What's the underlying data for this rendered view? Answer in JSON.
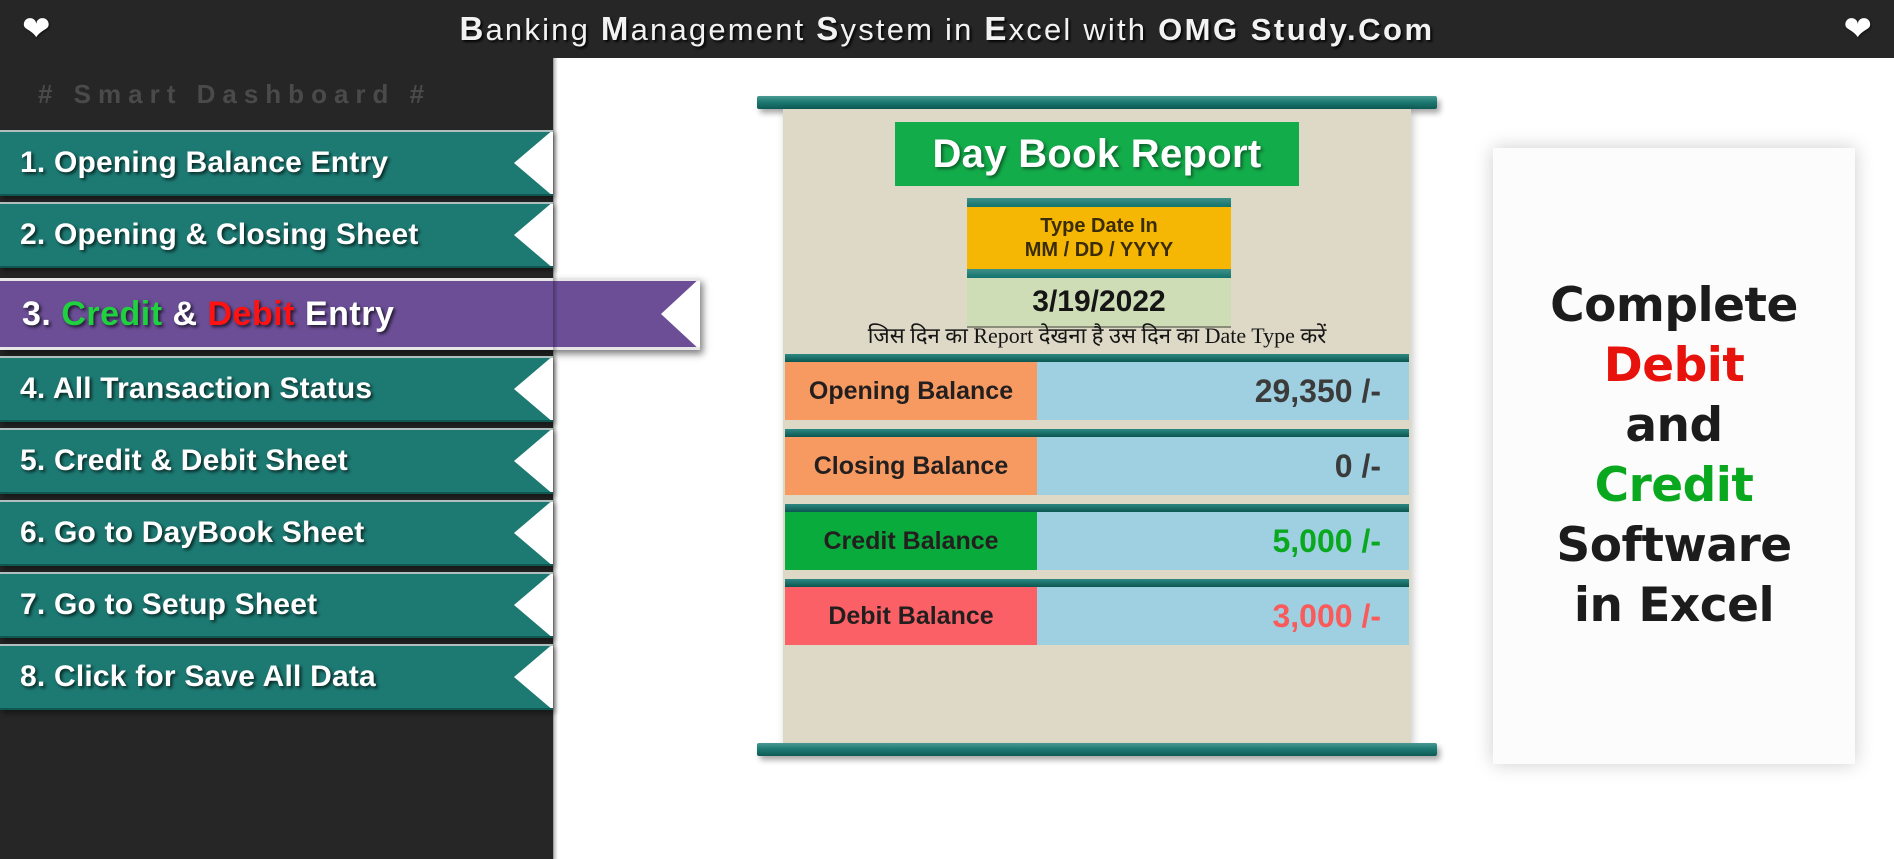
{
  "header": {
    "heart_icon": "heart",
    "title_parts": [
      {
        "text": "B",
        "style": "cap"
      },
      {
        "text": "anking ",
        "style": "normal"
      },
      {
        "text": "M",
        "style": "cap"
      },
      {
        "text": "anagement ",
        "style": "normal"
      },
      {
        "text": "S",
        "style": "cap"
      },
      {
        "text": "ystem in ",
        "style": "normal"
      },
      {
        "text": "E",
        "style": "cap"
      },
      {
        "text": "xcel with ",
        "style": "normal"
      },
      {
        "text": "OMG Study.Com",
        "style": "bold"
      }
    ],
    "title_plain": "Banking Management System in Excel with OMG Study.Com"
  },
  "sidebar": {
    "section_label": "# Smart Dashboard #",
    "items": [
      {
        "label": "1. Opening Balance Entry",
        "active": false
      },
      {
        "label": "2. Opening & Closing Sheet",
        "active": false
      },
      {
        "label": "3.  Credit & Debit Entry",
        "active": true,
        "parts": [
          {
            "text": "3. ",
            "color": "white"
          },
          {
            "text": " Credit ",
            "color": "green"
          },
          {
            "text": "& ",
            "color": "white"
          },
          {
            "text": "Debit ",
            "color": "red"
          },
          {
            "text": "Entry",
            "color": "white"
          }
        ]
      },
      {
        "label": "4.  All Transaction Status",
        "active": false
      },
      {
        "label": "5.  Credit & Debit Sheet",
        "active": false
      },
      {
        "label": "6.  Go to DayBook Sheet",
        "active": false
      },
      {
        "label": "7.  Go to Setup Sheet",
        "active": false
      },
      {
        "label": "8.  Click for Save All Data",
        "active": false
      }
    ]
  },
  "report": {
    "title": "Day Book Report",
    "date_hint_line1": "Type Date In",
    "date_hint_line2": "MM / DD / YYYY",
    "date_value": "3/19/2022",
    "date_note": "जिस दिन का Report देखना है उस दिन का Date Type करें",
    "rows": [
      {
        "name": "Opening Balance",
        "value": "29,350 /-",
        "name_bg": "#f79a62",
        "value_color": "#3b3b3b"
      },
      {
        "name": "Closing Balance",
        "value": "0 /-",
        "name_bg": "#f79a62",
        "value_color": "#3b3b3b"
      },
      {
        "name": "Credit Balance",
        "value": "5,000 /-",
        "name_bg": "#0aab3d",
        "value_color": "#09a81f"
      },
      {
        "name": "Debit Balance",
        "value": "3,000 /-",
        "name_bg": "#fb6066",
        "value_color": "#fb5a5a"
      }
    ]
  },
  "promo": {
    "lines": [
      {
        "text": "Complete",
        "color": "black"
      },
      {
        "text": "Debit",
        "color": "red"
      },
      {
        "text": "and",
        "color": "black"
      },
      {
        "text": "Credit",
        "color": "green"
      },
      {
        "text": "Software",
        "color": "black"
      },
      {
        "text": "in Excel",
        "color": "black"
      }
    ]
  },
  "colors": {
    "header_bg": "#262626",
    "menu_teal": "#1d7a73",
    "menu_active_purple": "#6b4e96",
    "report_paper": "#ded9c6",
    "title_green": "#13ac4a",
    "date_amber": "#f5b704",
    "date_value_bg": "#cfddb6",
    "value_blue": "#9ed0e2",
    "orange": "#f79a62",
    "green": "#0aab3d",
    "red": "#fb6066"
  }
}
